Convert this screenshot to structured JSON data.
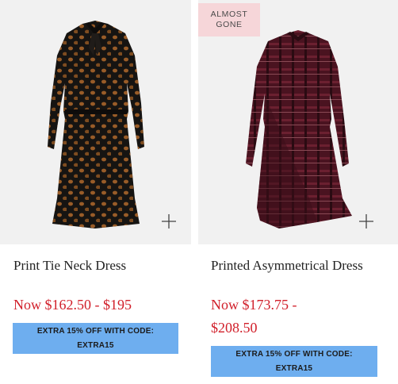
{
  "products": [
    {
      "name": "Print Tie Neck Dress",
      "price": "Now $162.50 - $195",
      "promo_line1": "EXTRA 15% OFF WITH CODE:",
      "promo_line2": "EXTRA15",
      "add_icon": "plus-icon"
    },
    {
      "badge_line1": "ALMOST",
      "badge_line2": "GONE",
      "name": "Printed Asymmetrical Dress",
      "price_line1": "Now $173.75 -",
      "price_line2": "$208.50",
      "promo_line1": "EXTRA 15% OFF WITH CODE:",
      "promo_line2": "EXTRA15",
      "add_icon": "plus-icon"
    }
  ],
  "colors": {
    "price_red": "#d11f2a",
    "promo_blue": "#6eaeef",
    "badge_pink": "#f6d6d9",
    "image_bg": "#f1f1f1"
  }
}
